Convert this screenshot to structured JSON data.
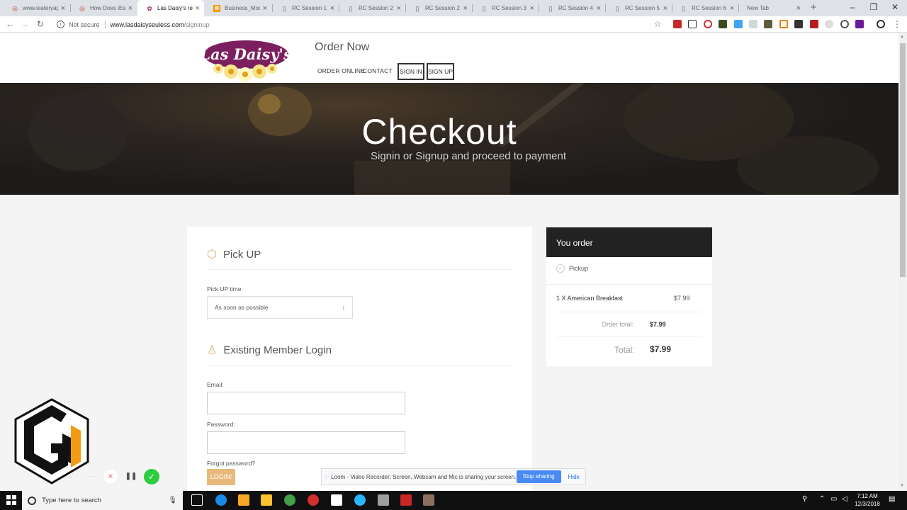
{
  "browser": {
    "tabs": [
      {
        "title": "www.ieateryapp",
        "favicon": "circle-red-icon"
      },
      {
        "title": "How Does iEat",
        "favicon": "circle-red-icon"
      },
      {
        "title": "Las Daisy's res",
        "favicon": "las-daisys-icon"
      },
      {
        "title": "Business_Mod",
        "favicon": "sheet-icon"
      },
      {
        "title": "RC Session 1",
        "favicon": "doc-icon"
      },
      {
        "title": "RC Session 2",
        "favicon": "doc-icon"
      },
      {
        "title": "RC Session 2",
        "favicon": "doc-icon"
      },
      {
        "title": "RC Session 3",
        "favicon": "doc-icon"
      },
      {
        "title": "RC Session 4",
        "favicon": "doc-icon"
      },
      {
        "title": "RC Session 5",
        "favicon": "doc-icon"
      },
      {
        "title": "RC Session 6",
        "favicon": "doc-icon"
      },
      {
        "title": "New Tab",
        "favicon": ""
      }
    ],
    "security_label": "Not secure",
    "url_host": "www.lasdaisyseuless.com",
    "url_path": "/signinup"
  },
  "site": {
    "brand": "Order Now",
    "logo_text": "Las Daisy's",
    "nav": {
      "order_online": "ORDER ONLINE",
      "contact": "CONTACT",
      "sign_in": "SIGN IN",
      "sign_up": "SIGN UP"
    }
  },
  "hero": {
    "title": "Checkout",
    "subtitle": "Signin or Signup and proceed to payment"
  },
  "checkout": {
    "pickup_title": "Pick UP",
    "pickup_time_label": "Pick UP time:",
    "pickup_time_value": "As soon as possible",
    "login_title": "Existing Member Login",
    "email_label": "Email:",
    "password_label": "Password:",
    "forgot_password": "Forgot password?",
    "login_button": "LOGIN!"
  },
  "order": {
    "header": "You order",
    "method": "Pickup",
    "item": "1 X American Breakfast",
    "item_price": "$7.99",
    "order_total_label": "Order total:",
    "order_total_value": "$7.99",
    "total_label": "Total:",
    "total_value": "$7.99"
  },
  "loom": {
    "message": "Loom - Video Recorder: Screen, Webcam and Mic is sharing your screen.",
    "stop_button": "Stop sharing",
    "hide_button": "Hide"
  },
  "taskbar": {
    "search_placeholder": "Type here to search",
    "time": "7:12 AM",
    "date": "12/3/2018"
  },
  "colors": {
    "accent": "#e0b16a",
    "header_dark": "#222222",
    "loom_blue": "#4a8af4",
    "login_button": "#e8b97a"
  }
}
